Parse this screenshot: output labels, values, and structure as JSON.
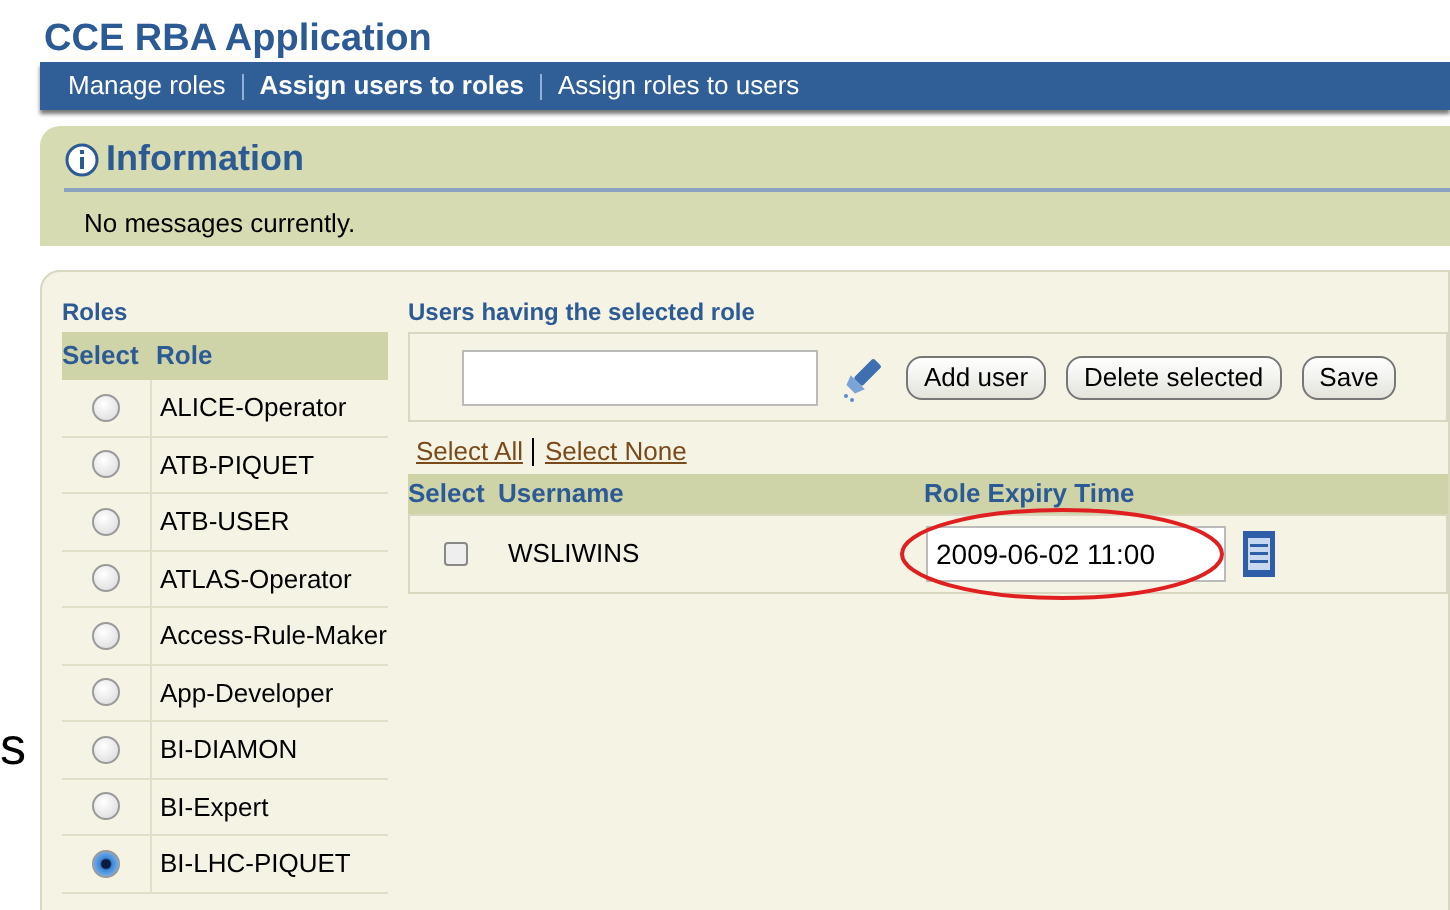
{
  "app_title": "CCE RBA Application",
  "nav": [
    {
      "label": "Manage roles",
      "selected": false
    },
    {
      "label": "Assign users to roles",
      "selected": true
    },
    {
      "label": "Assign roles to users",
      "selected": false
    }
  ],
  "info": {
    "title": "Information",
    "message": "No messages currently."
  },
  "roles": {
    "title": "Roles",
    "columns": [
      "Select",
      "Role"
    ],
    "rows": [
      {
        "name": "ALICE-Operator",
        "selected": false
      },
      {
        "name": "ATB-PIQUET",
        "selected": false
      },
      {
        "name": "ATB-USER",
        "selected": false
      },
      {
        "name": "ATLAS-Operator",
        "selected": false
      },
      {
        "name": "Access-Rule-Maker",
        "selected": false
      },
      {
        "name": "App-Developer",
        "selected": false
      },
      {
        "name": "BI-DIAMON",
        "selected": false
      },
      {
        "name": "BI-Expert",
        "selected": false
      },
      {
        "name": "BI-LHC-PIQUET",
        "selected": true
      }
    ]
  },
  "users": {
    "title": "Users having the selected role",
    "buttons": [
      "Add user",
      "Delete selected",
      "Save"
    ],
    "links": [
      "Select All",
      "Select None"
    ],
    "columns": [
      "Select",
      "Username",
      "Role Expiry Time"
    ],
    "rows": [
      {
        "username": "WSLIWINS",
        "checked": false,
        "expiry": "2009-06-02 11:00"
      }
    ]
  },
  "margin_fragment": "s"
}
